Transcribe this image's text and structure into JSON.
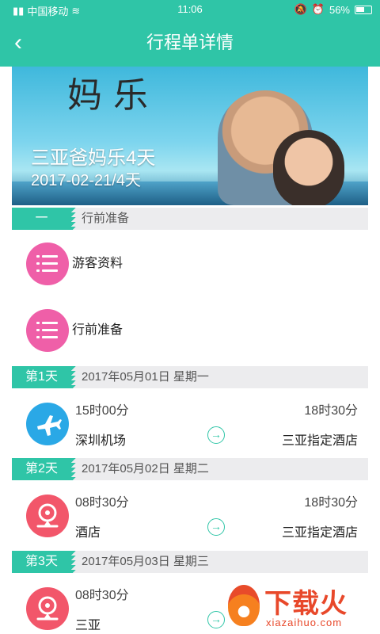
{
  "status_bar": {
    "carrier": "中国移动",
    "time": "11:06",
    "battery": "56%"
  },
  "nav": {
    "title": "行程单详情",
    "back_icon": "chevron-left-icon"
  },
  "banner": {
    "poster_text": "妈 乐",
    "trip_name": "三亚爸妈乐4天",
    "trip_date": "2017-02-21/4天"
  },
  "prep_section": {
    "tag": "一",
    "label": "行前准备",
    "items": [
      {
        "label": "游客资料",
        "icon": "checklist-icon",
        "color": "#ef5fa8"
      },
      {
        "label": "行前准备",
        "icon": "checklist-icon",
        "color": "#ef5fa8"
      }
    ]
  },
  "days": [
    {
      "tag": "第1天",
      "date": "2017年05月01日 星期一",
      "icon": "airplane-icon",
      "icon_color": "#2aa8e6",
      "depart_time": "15时00分",
      "arrive_time": "18时30分",
      "depart_place": "深圳机场",
      "arrive_place": "三亚指定酒店"
    },
    {
      "tag": "第2天",
      "date": "2017年05月02日 星期二",
      "icon": "location-pin-icon",
      "icon_color": "#f2566a",
      "depart_time": "08时30分",
      "arrive_time": "18时30分",
      "depart_place": "酒店",
      "arrive_place": "三亚指定酒店"
    },
    {
      "tag": "第3天",
      "date": "2017年05月03日 星期三",
      "icon": "location-pin-icon",
      "icon_color": "#f2566a",
      "depart_time": "08时30分",
      "arrive_time": "",
      "depart_place": "三亚",
      "arrive_place": ""
    }
  ],
  "watermark": {
    "cn": "下载火",
    "en": "xiazaihuo.com"
  }
}
